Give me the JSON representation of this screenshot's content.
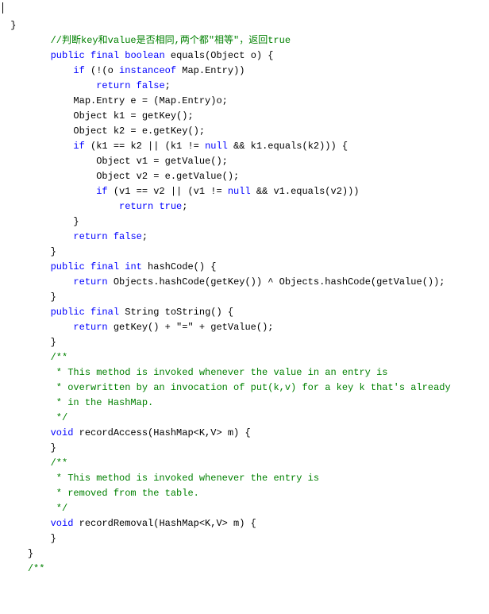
{
  "lines": [
    {
      "indent": 0,
      "segments": [
        {
          "cls": "",
          "text": " }"
        }
      ]
    },
    {
      "indent": 0,
      "segments": [
        {
          "cls": "",
          "text": ""
        }
      ]
    },
    {
      "indent": 2,
      "segments": [
        {
          "cls": "comment",
          "text": "//判断key和value是否相同,两个都\"相等\"，返回true"
        }
      ]
    },
    {
      "indent": 2,
      "segments": [
        {
          "cls": "keyword",
          "text": "public"
        },
        {
          "cls": "",
          "text": " "
        },
        {
          "cls": "keyword",
          "text": "final"
        },
        {
          "cls": "",
          "text": " "
        },
        {
          "cls": "keyword",
          "text": "boolean"
        },
        {
          "cls": "",
          "text": " equals(Object o) {"
        }
      ]
    },
    {
      "indent": 3,
      "segments": [
        {
          "cls": "keyword",
          "text": "if"
        },
        {
          "cls": "",
          "text": " (!(o "
        },
        {
          "cls": "keyword",
          "text": "instanceof"
        },
        {
          "cls": "",
          "text": " Map.Entry))"
        }
      ]
    },
    {
      "indent": 4,
      "segments": [
        {
          "cls": "keyword",
          "text": "return"
        },
        {
          "cls": "",
          "text": " "
        },
        {
          "cls": "keyword",
          "text": "false"
        },
        {
          "cls": "",
          "text": ";"
        }
      ]
    },
    {
      "indent": 3,
      "segments": [
        {
          "cls": "",
          "text": "Map.Entry e = (Map.Entry)o;"
        }
      ]
    },
    {
      "indent": 3,
      "segments": [
        {
          "cls": "",
          "text": "Object k1 = getKey();"
        }
      ]
    },
    {
      "indent": 3,
      "segments": [
        {
          "cls": "",
          "text": "Object k2 = e.getKey();"
        }
      ]
    },
    {
      "indent": 3,
      "segments": [
        {
          "cls": "keyword",
          "text": "if"
        },
        {
          "cls": "",
          "text": " (k1 == k2 || (k1 != "
        },
        {
          "cls": "keyword",
          "text": "null"
        },
        {
          "cls": "",
          "text": " && k1.equals(k2))) {"
        }
      ]
    },
    {
      "indent": 4,
      "segments": [
        {
          "cls": "",
          "text": "Object v1 = getValue();"
        }
      ]
    },
    {
      "indent": 4,
      "segments": [
        {
          "cls": "",
          "text": "Object v2 = e.getValue();"
        }
      ]
    },
    {
      "indent": 4,
      "segments": [
        {
          "cls": "keyword",
          "text": "if"
        },
        {
          "cls": "",
          "text": " (v1 == v2 || (v1 != "
        },
        {
          "cls": "keyword",
          "text": "null"
        },
        {
          "cls": "",
          "text": " && v1.equals(v2)))"
        }
      ]
    },
    {
      "indent": 5,
      "segments": [
        {
          "cls": "keyword",
          "text": "return"
        },
        {
          "cls": "",
          "text": " "
        },
        {
          "cls": "keyword",
          "text": "true"
        },
        {
          "cls": "",
          "text": ";"
        }
      ]
    },
    {
      "indent": 3,
      "segments": [
        {
          "cls": "",
          "text": "}"
        }
      ]
    },
    {
      "indent": 3,
      "segments": [
        {
          "cls": "keyword",
          "text": "return"
        },
        {
          "cls": "",
          "text": " "
        },
        {
          "cls": "keyword",
          "text": "false"
        },
        {
          "cls": "",
          "text": ";"
        }
      ]
    },
    {
      "indent": 2,
      "segments": [
        {
          "cls": "",
          "text": "}"
        }
      ]
    },
    {
      "indent": 0,
      "segments": [
        {
          "cls": "",
          "text": ""
        }
      ]
    },
    {
      "indent": 2,
      "segments": [
        {
          "cls": "keyword",
          "text": "public"
        },
        {
          "cls": "",
          "text": " "
        },
        {
          "cls": "keyword",
          "text": "final"
        },
        {
          "cls": "",
          "text": " "
        },
        {
          "cls": "keyword",
          "text": "int"
        },
        {
          "cls": "",
          "text": " hashCode() {"
        }
      ]
    },
    {
      "indent": 3,
      "segments": [
        {
          "cls": "keyword",
          "text": "return"
        },
        {
          "cls": "",
          "text": " Objects.hashCode(getKey()) ^ Objects.hashCode(getValue());"
        }
      ]
    },
    {
      "indent": 2,
      "segments": [
        {
          "cls": "",
          "text": "}"
        }
      ]
    },
    {
      "indent": 0,
      "segments": [
        {
          "cls": "",
          "text": ""
        }
      ]
    },
    {
      "indent": 2,
      "segments": [
        {
          "cls": "keyword",
          "text": "public"
        },
        {
          "cls": "",
          "text": " "
        },
        {
          "cls": "keyword",
          "text": "final"
        },
        {
          "cls": "",
          "text": " String toString() {"
        }
      ]
    },
    {
      "indent": 3,
      "segments": [
        {
          "cls": "keyword",
          "text": "return"
        },
        {
          "cls": "",
          "text": " getKey() + \"=\" + getValue();"
        }
      ]
    },
    {
      "indent": 2,
      "segments": [
        {
          "cls": "",
          "text": "}"
        }
      ]
    },
    {
      "indent": 0,
      "segments": [
        {
          "cls": "",
          "text": ""
        }
      ]
    },
    {
      "indent": 2,
      "segments": [
        {
          "cls": "comment",
          "text": "/**"
        }
      ]
    },
    {
      "indent": 2,
      "segments": [
        {
          "cls": "comment",
          "text": " * This method is invoked whenever the value in an entry is"
        }
      ]
    },
    {
      "indent": 2,
      "segments": [
        {
          "cls": "comment",
          "text": " * overwritten by an invocation of put(k,v) for a key k that's already"
        }
      ]
    },
    {
      "indent": 2,
      "segments": [
        {
          "cls": "comment",
          "text": " * in the HashMap."
        }
      ]
    },
    {
      "indent": 2,
      "segments": [
        {
          "cls": "comment",
          "text": " */"
        }
      ]
    },
    {
      "indent": 2,
      "segments": [
        {
          "cls": "keyword",
          "text": "void"
        },
        {
          "cls": "",
          "text": " recordAccess(HashMap<K,V> m) {"
        }
      ]
    },
    {
      "indent": 2,
      "segments": [
        {
          "cls": "",
          "text": "}"
        }
      ]
    },
    {
      "indent": 0,
      "segments": [
        {
          "cls": "",
          "text": ""
        }
      ]
    },
    {
      "indent": 2,
      "segments": [
        {
          "cls": "comment",
          "text": "/**"
        }
      ]
    },
    {
      "indent": 2,
      "segments": [
        {
          "cls": "comment",
          "text": " * This method is invoked whenever the entry is"
        }
      ]
    },
    {
      "indent": 2,
      "segments": [
        {
          "cls": "comment",
          "text": " * removed from the table."
        }
      ]
    },
    {
      "indent": 2,
      "segments": [
        {
          "cls": "comment",
          "text": " */"
        }
      ]
    },
    {
      "indent": 2,
      "segments": [
        {
          "cls": "keyword",
          "text": "void"
        },
        {
          "cls": "",
          "text": " recordRemoval(HashMap<K,V> m) {"
        }
      ]
    },
    {
      "indent": 2,
      "segments": [
        {
          "cls": "",
          "text": "}"
        }
      ]
    },
    {
      "indent": 1,
      "segments": [
        {
          "cls": "",
          "text": "}"
        }
      ]
    },
    {
      "indent": 0,
      "segments": [
        {
          "cls": "",
          "text": ""
        }
      ]
    },
    {
      "indent": 1,
      "segments": [
        {
          "cls": "comment",
          "text": "/**"
        }
      ]
    }
  ],
  "indent_unit": "    "
}
